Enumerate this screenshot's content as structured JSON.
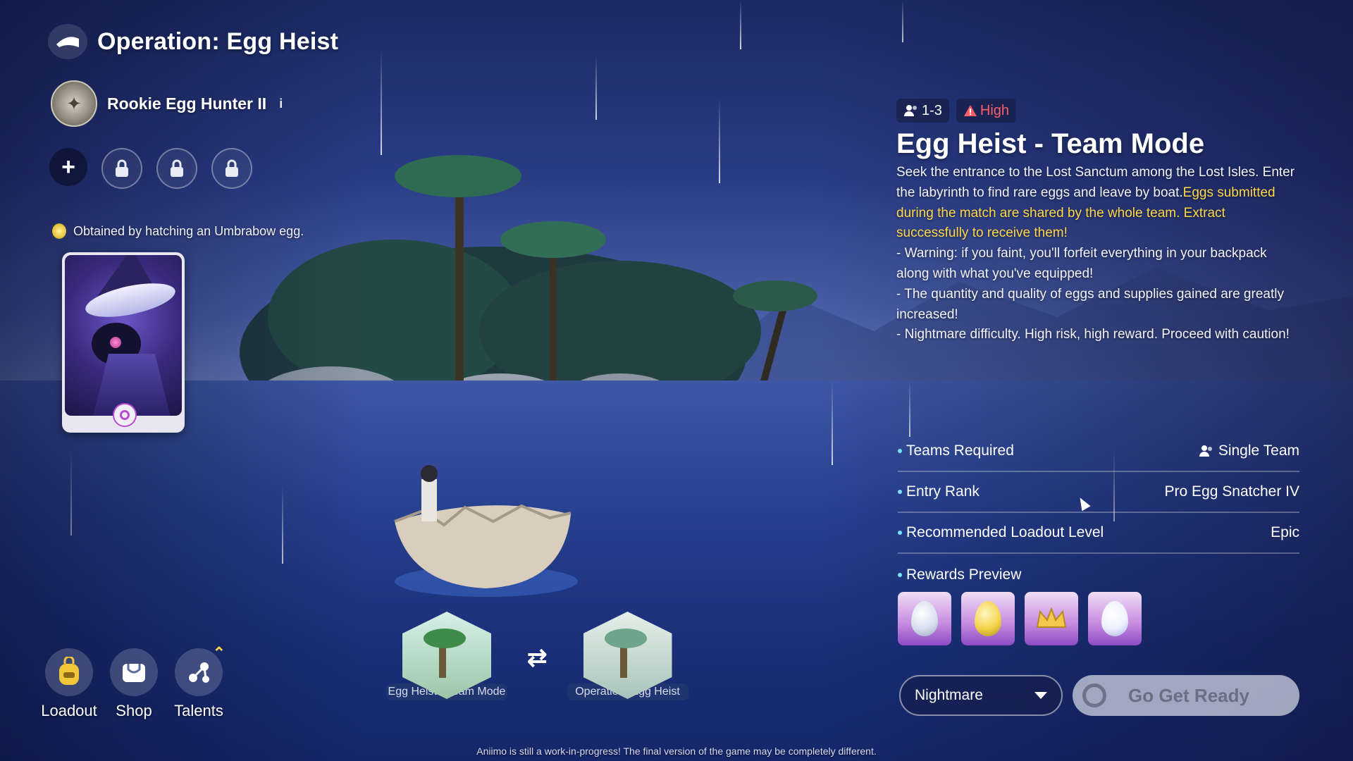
{
  "header": {
    "title": "Operation: Egg Heist",
    "rank_name": "Rookie Egg Hunter II",
    "info_glyph": "i"
  },
  "slots": {
    "add_glyph": "+"
  },
  "pet": {
    "obtained_text": "Obtained by hatching an Umbrabow egg."
  },
  "bottom_nav": [
    {
      "label": "Loadout",
      "icon": "backpack-icon"
    },
    {
      "label": "Shop",
      "icon": "shop-bag-icon"
    },
    {
      "label": "Talents",
      "icon": "talents-icon"
    }
  ],
  "modes": {
    "current": "Egg Heist - Team Mode",
    "other": "Operation: Egg Heist",
    "swap_glyph": "⇄"
  },
  "panel": {
    "players": "1-3",
    "risk": "High",
    "title": "Egg Heist - Team Mode",
    "desc_intro": "Seek the entrance to the Lost Sanctum among the Lost Isles. Enter the labyrinth to find rare eggs and leave by boat.",
    "desc_highlight": "Eggs submitted during the match are shared by the whole team. Extract successfully to receive them!",
    "warnings": [
      "- Warning: if you faint, you'll forfeit everything in your backpack along with what you've equipped!",
      "- The quantity and quality of eggs and supplies gained are greatly increased!",
      "- Nightmare difficulty. High risk, high reward. Proceed with caution!"
    ]
  },
  "stats": [
    {
      "key": "Teams Required",
      "value": "Single Team"
    },
    {
      "key": "Entry Rank",
      "value": "Pro Egg Snatcher IV"
    },
    {
      "key": "Recommended Loadout Level",
      "value": "Epic"
    }
  ],
  "rewards": {
    "heading": "Rewards Preview",
    "items": [
      {
        "name": "silver-egg",
        "color": "#d8dfee"
      },
      {
        "name": "golden-egg",
        "color": "#f4d34a"
      },
      {
        "name": "crown",
        "color": "#f2c94c"
      },
      {
        "name": "white-egg",
        "color": "#eef0ff"
      }
    ]
  },
  "actions": {
    "difficulty": "Nightmare",
    "go_label": "Go Get Ready"
  },
  "footer": "Aniimo is still a work-in-progress! The final version of the game may be completely different.",
  "colors": {
    "highlight": "#ffd84a",
    "danger": "#ff5d6b"
  }
}
